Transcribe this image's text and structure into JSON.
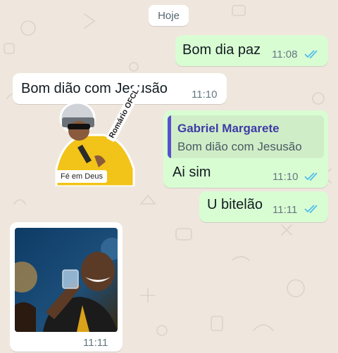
{
  "chat": {
    "date_label": "Hoje",
    "messages": [
      {
        "text": "Bom dia paz",
        "time": "11:08"
      },
      {
        "text": "Bom dião com Jesusão",
        "time": "11:10"
      },
      {
        "sticker_caption": "Fé em Deus",
        "sticker_side_text": "Romário OFCL"
      },
      {
        "quote_author": "Gabriel Margarete",
        "quote_text": "Bom dião com Jesusão",
        "text": "Ai sim",
        "time": "11:10"
      },
      {
        "text": "U bitelão",
        "time": "11:11"
      },
      {
        "time": "11:11"
      }
    ]
  },
  "colors": {
    "outgoing_bubble": "#d9fdd3",
    "incoming_bubble": "#ffffff",
    "read_ticks": "#53bdeb",
    "quote_author": "#3f3aa6",
    "wallpaper": "#efe7de"
  },
  "icons": [
    "double-check-icon"
  ]
}
